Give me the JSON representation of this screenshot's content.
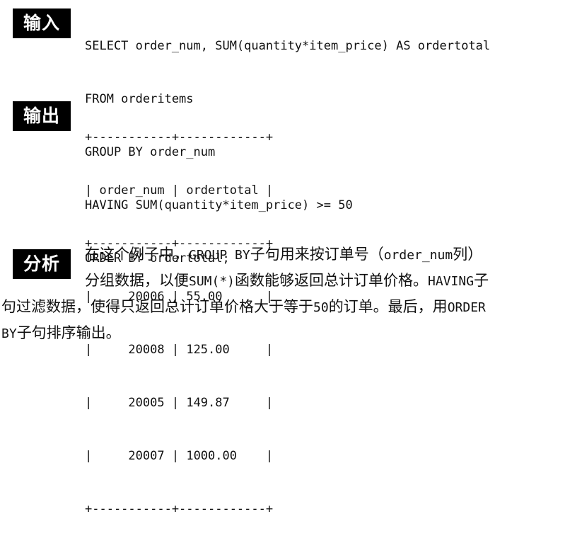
{
  "labels": {
    "input": "输入",
    "output": "输出",
    "analysis": "分析"
  },
  "sql_lines": [
    "SELECT order_num, SUM(quantity*item_price) AS ordertotal",
    "FROM orderitems",
    "GROUP BY order_num",
    "HAVING SUM(quantity*item_price) >= 50",
    "ORDER BY ordertotal;"
  ],
  "result_table": {
    "border": "+-----------+------------+",
    "columns": [
      "order_num",
      "ordertotal"
    ],
    "rows": [
      [
        "20006",
        "55.00"
      ],
      [
        "20008",
        "125.00"
      ],
      [
        "20005",
        "149.87"
      ],
      [
        "20007",
        "1000.00"
      ]
    ]
  },
  "analysis": {
    "line1_a": "在这个例子中，",
    "line1_b": "GROUP BY",
    "line1_c": "子句用来按订单号（",
    "line1_d": "order_num",
    "line1_e": "列）",
    "line2_a": "分组数据，以便",
    "line2_b": "SUM(*)",
    "line2_c": "函数能够返回总计订单价格。",
    "line2_d": "HAVING",
    "line2_e": "子",
    "line3_a": "句过滤数据，使得只返回总计订单价格大于等于",
    "line3_b": "50",
    "line3_c": "的订单。最后，用",
    "line3_d": "ORDER",
    "line4_a": "BY",
    "line4_b": "子句排序输出。"
  }
}
